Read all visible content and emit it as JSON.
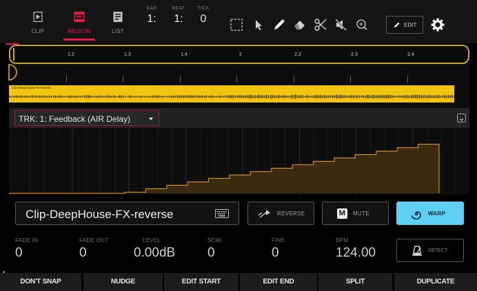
{
  "tabs": [
    {
      "label": "CLIP",
      "icon": "clip-icon",
      "active": false
    },
    {
      "label": "REGION",
      "icon": "region-icon",
      "active": true
    },
    {
      "label": "LIST",
      "icon": "list-icon",
      "active": false
    }
  ],
  "counters": {
    "bar": {
      "label": "BAR",
      "value": "1:"
    },
    "beat": {
      "label": "BEAT",
      "value": "1:"
    },
    "tick": {
      "label": "TICK",
      "value": "0"
    }
  },
  "tools": [
    "marquee-select-icon",
    "pointer-icon",
    "pencil-icon",
    "eraser-icon",
    "scissors-icon",
    "mute-tool-icon",
    "zoom-icon"
  ],
  "edit_button": {
    "label": "EDIT"
  },
  "ruler": {
    "marks": [
      "1.2",
      "1.3",
      "1.4",
      "2",
      "2.2",
      "2.3",
      "2.4"
    ]
  },
  "clip": {
    "name_small": "Clip-DeepHouse-FX-reverse",
    "color": "#f1c40f"
  },
  "track_selector": {
    "value": "TRK: 1: Feedback (AIR Delay)"
  },
  "automation": {
    "color": "#c98a1a",
    "fill": "#3a2a10",
    "step_values": [
      0.02,
      0.08,
      0.14,
      0.2,
      0.26,
      0.32,
      0.38,
      0.44,
      0.5,
      0.56,
      0.62,
      0.68,
      0.74,
      0.8,
      0.86
    ]
  },
  "clip_name_field": {
    "value": "Clip-DeepHouse-FX-reverse"
  },
  "buttons": {
    "reverse": "REVERSE",
    "mute": "MUTE",
    "mute_badge": "M",
    "warp": "WARP",
    "detect": "DETECT"
  },
  "params": {
    "fade_in": {
      "label": "FADE IN",
      "value": "0"
    },
    "fade_out": {
      "label": "FADE OUT",
      "value": "0"
    },
    "level": {
      "label": "LEVEL",
      "value": "0.00dB"
    },
    "semi": {
      "label": "SEMI",
      "value": "0"
    },
    "fine": {
      "label": "FINE",
      "value": "0"
    },
    "bpm": {
      "label": "BPM",
      "value": "124.00"
    }
  },
  "bottom_bar": [
    "DON'T SNAP",
    "NUDGE",
    "EDIT START",
    "EDIT END",
    "SPLIT",
    "DUPLICATE"
  ],
  "colors": {
    "accent": "#e4194a",
    "warp": "#5ed0f5",
    "region_outline": "#c9a60a"
  }
}
